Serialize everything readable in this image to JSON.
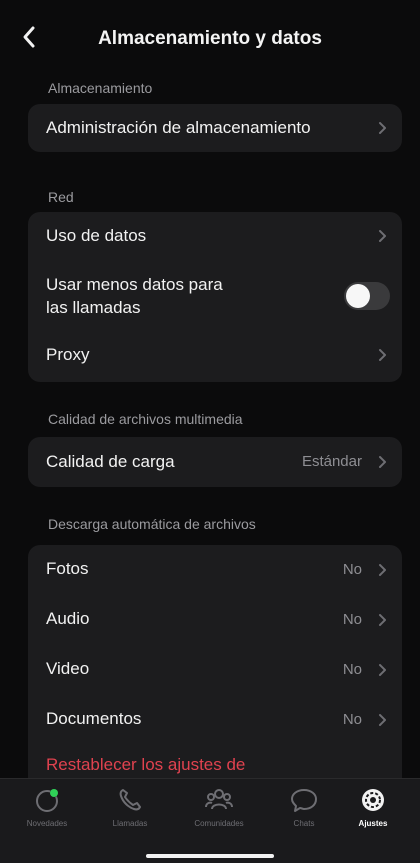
{
  "header": {
    "title": "Almacenamiento y datos"
  },
  "sections": {
    "storage": "Almacenamiento",
    "network": "Red",
    "media_quality": "Calidad de archivos multimedia",
    "auto_download": "Descarga automática de archivos"
  },
  "rows": {
    "storage_management": "Administración de almacenamiento",
    "data_usage": "Uso de datos",
    "use_less_data_line1": "Usar menos datos para",
    "use_less_data_line2": "las llamadas",
    "use_less_data_enabled": false,
    "proxy": "Proxy",
    "upload_quality": "Calidad de carga",
    "upload_quality_value": "Estándar",
    "photos": "Fotos",
    "photos_value": "No",
    "audio": "Audio",
    "audio_value": "No",
    "video": "Video",
    "video_value": "No",
    "documents": "Documentos",
    "documents_value": "No"
  },
  "reset_label": "Restablecer los ajustes de",
  "tabs": [
    {
      "label": "Novedades",
      "icon": "updates-icon",
      "active": false
    },
    {
      "label": "Llamadas",
      "icon": "phone-icon",
      "active": false
    },
    {
      "label": "Comunidades",
      "icon": "communities-icon",
      "active": false
    },
    {
      "label": "Chats",
      "icon": "chat-bubble-icon",
      "active": false
    },
    {
      "label": "Ajustes",
      "icon": "settings-gear-icon",
      "active": true
    }
  ],
  "colors": {
    "background": "#0b0b0c",
    "card": "#1c1c1e",
    "accent_red": "#e0424f",
    "status_dot": "#30d158"
  }
}
